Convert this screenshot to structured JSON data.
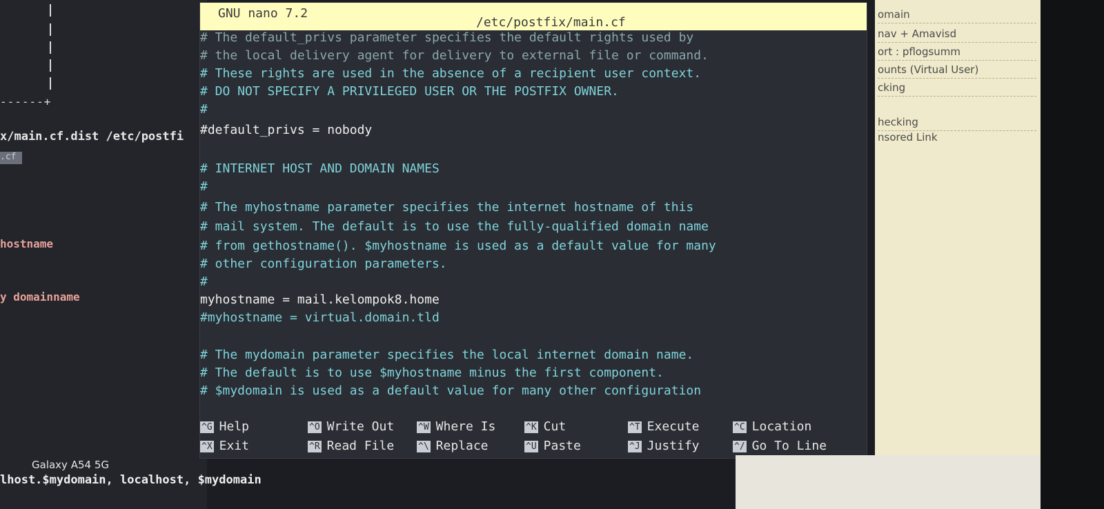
{
  "terminal": {
    "partial_path": "x/main.cf.dist /etc/postfi",
    "highlight": ".cf",
    "dashes": "------+",
    "left_labels": [
      " hostname",
      "y domainname"
    ],
    "bottom_line": "lhost.$mydomain, localhost, $mydomain"
  },
  "watermark": "Galaxy A54 5G",
  "nano": {
    "app": "GNU nano 7.2",
    "file": "/etc/postfix/main.cf",
    "lines": [
      "# The default_privs parameter specifies the default rights used by",
      "# the local delivery agent for delivery to external file or command.",
      "# These rights are used in the absence of a recipient user context.",
      "# DO NOT SPECIFY A PRIVILEGED USER OR THE POSTFIX OWNER.",
      "#",
      "#default_privs = nobody",
      "",
      "# INTERNET HOST AND DOMAIN NAMES",
      "#",
      "# The myhostname parameter specifies the internet hostname of this",
      "# mail system. The default is to use the fully-qualified domain name",
      "# from gethostname(). $myhostname is used as a default value for many",
      "# other configuration parameters.",
      "#",
      "myhostname = mail.kelompok8.home",
      "#myhostname = virtual.domain.tld",
      "",
      "# The mydomain parameter specifies the local internet domain name.",
      "# The default is to use $myhostname minus the first component.",
      "# $mydomain is used as a default value for many other configuration"
    ],
    "shortcuts": [
      {
        "key": "^G",
        "label": "Help"
      },
      {
        "key": "^O",
        "label": "Write Out"
      },
      {
        "key": "^W",
        "label": "Where Is"
      },
      {
        "key": "^K",
        "label": "Cut"
      },
      {
        "key": "^T",
        "label": "Execute"
      },
      {
        "key": "^C",
        "label": "Location"
      },
      {
        "key": "^X",
        "label": "Exit"
      },
      {
        "key": "^R",
        "label": "Read File"
      },
      {
        "key": "^\\",
        "label": "Replace"
      },
      {
        "key": "^U",
        "label": "Paste"
      },
      {
        "key": "^J",
        "label": "Justify"
      },
      {
        "key": "^/",
        "label": "Go To Line"
      }
    ]
  },
  "browser": {
    "items": [
      "omain",
      "nav + Amavisd",
      "ort : pflogsumm",
      "ounts (Virtual User)",
      "cking",
      "hecking",
      "nsored Link"
    ]
  }
}
